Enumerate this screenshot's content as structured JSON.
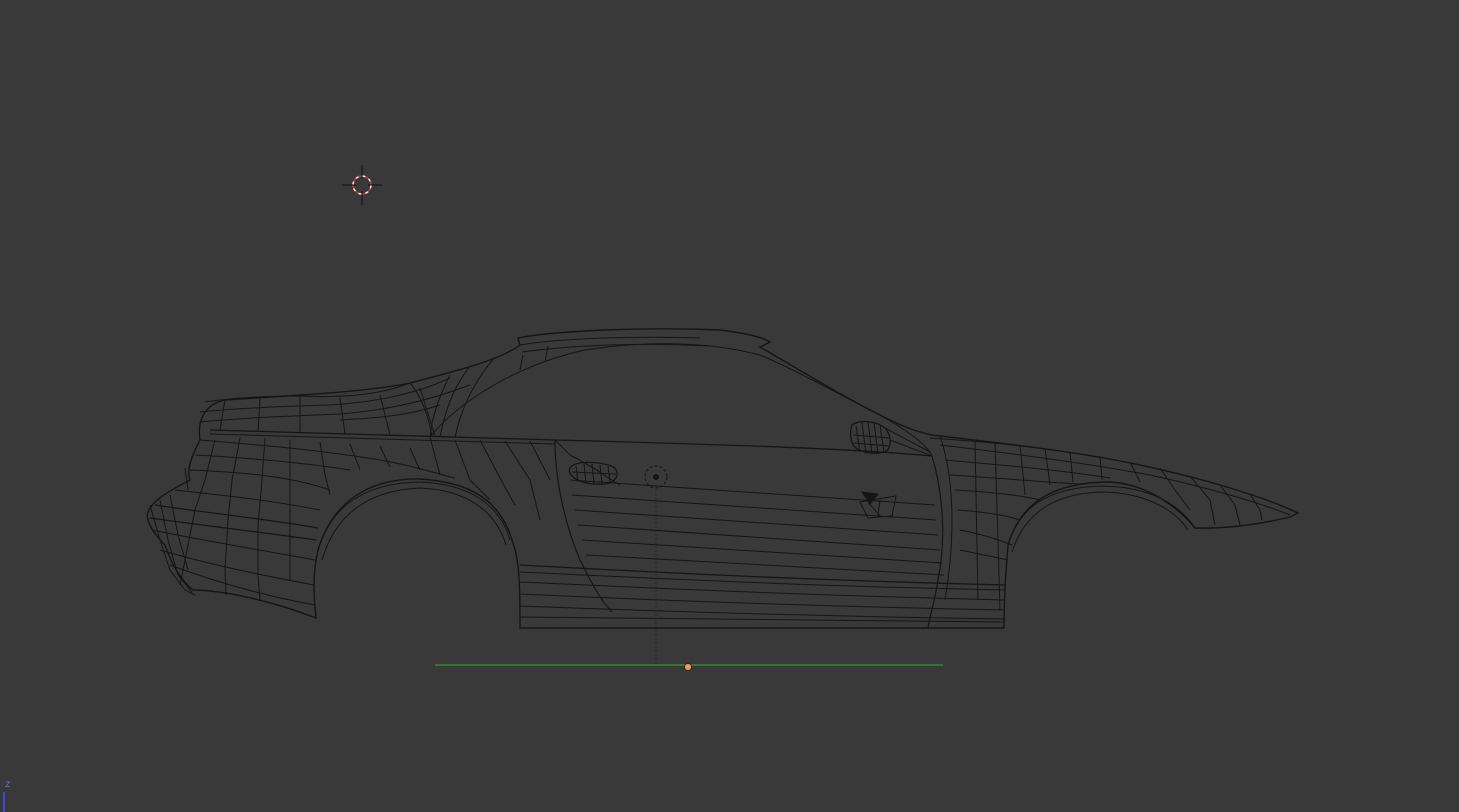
{
  "viewport": {
    "background": "#393939",
    "mode": "wireframe",
    "object_name": "car-body-wireframe"
  },
  "orientation_gizmo": {
    "axis_label": "z",
    "axis_color": "#4646d8"
  },
  "colors": {
    "wire": "#151515",
    "ground_line": "#2f9a2f",
    "origin_dot": "#e8a050",
    "cursor_red": "#c83232",
    "cursor_white": "#f0f0f0"
  }
}
